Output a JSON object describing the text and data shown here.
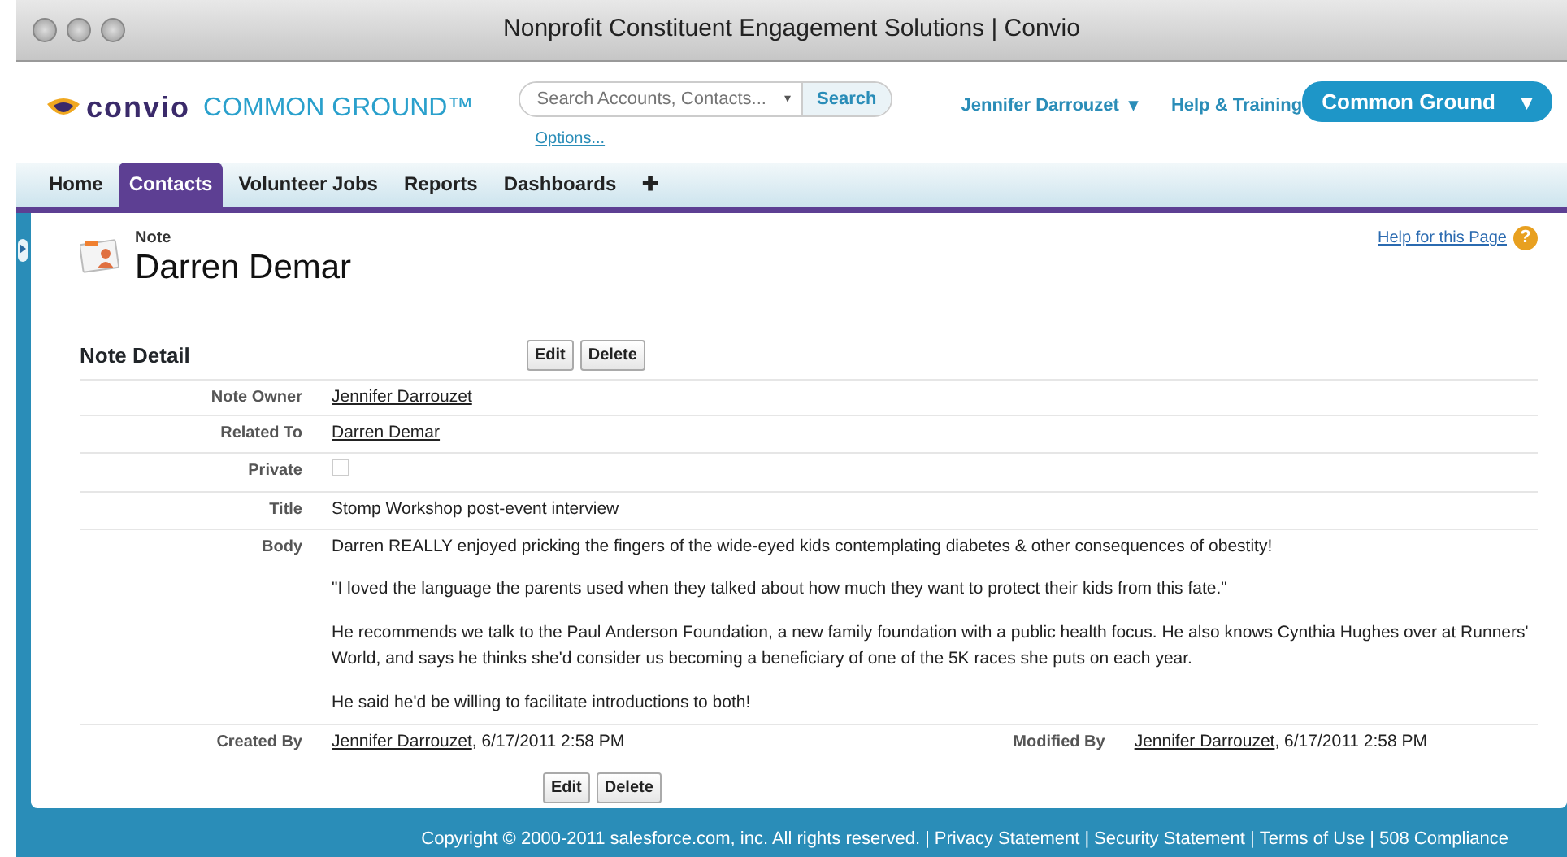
{
  "window": {
    "title": "Nonprofit Constituent Engagement Solutions | Convio"
  },
  "header": {
    "logo_brand": "convio",
    "logo_product": "COMMON GROUND™",
    "search": {
      "placeholder": "Search Accounts, Contacts...",
      "caret": "▾",
      "button": "Search",
      "options": "Options..."
    },
    "user_menu": "Jennifer Darrouzet",
    "user_menu_caret": "▾",
    "help_link": "Help & Training",
    "app_menu": "Common Ground",
    "app_menu_caret": "▾"
  },
  "tabs": [
    {
      "label": "Home",
      "selected": false
    },
    {
      "label": "Contacts",
      "selected": true
    },
    {
      "label": "Volunteer Jobs",
      "selected": false
    },
    {
      "label": "Reports",
      "selected": false
    },
    {
      "label": "Dashboards",
      "selected": false
    },
    {
      "label": "✚",
      "selected": false
    }
  ],
  "page": {
    "record_type": "Note",
    "title": "Darren Demar",
    "help": "Help for this Page",
    "help_icon": "?"
  },
  "detail": {
    "title": "Note Detail",
    "buttons": [
      "Edit",
      "Delete"
    ],
    "fields": [
      {
        "label": "Note Owner",
        "kind": "link",
        "value": "Jennifer Darrouzet"
      },
      {
        "label": "Related To",
        "kind": "link",
        "value": "Darren Demar"
      },
      {
        "label": "Private",
        "kind": "checkbox",
        "checked": false
      },
      {
        "label": "Title",
        "kind": "text",
        "value": "Stomp Workshop post-event interview"
      },
      {
        "label": "Body",
        "kind": "paragraphs",
        "paragraphs": [
          "Darren REALLY enjoyed pricking the fingers of the wide-eyed kids contemplating diabetes & other consequences of obestity!",
          "\"I loved the language the parents used when they talked about how much they want to protect their kids from this fate.\"",
          "He recommends we talk to the Paul Anderson Foundation, a new family foundation with a public health focus. He also knows Cynthia Hughes over at Runners' World, and says he thinks she'd consider us becoming a beneficiary of one of the 5K races she puts on each year.",
          "He said he'd be willing to facilitate introductions to both!"
        ]
      }
    ],
    "audit": [
      {
        "label": "Created By",
        "user": "Jennifer Darrouzet",
        "date": ", 6/17/2011 2:58 PM"
      },
      {
        "label": "Modified By",
        "user": "Jennifer Darrouzet",
        "date": ", 6/17/2011 2:58 PM"
      }
    ],
    "bottom_buttons": [
      "Edit",
      "Delete"
    ]
  },
  "footer": {
    "copyright": "Copyright © 2000-2011 salesforce.com, inc. All rights reserved.",
    "separators": [
      "|",
      "|",
      "|",
      "|"
    ],
    "links": [
      "Privacy Statement",
      "Security Statement",
      "Terms of Use",
      "508 Compliance"
    ]
  }
}
